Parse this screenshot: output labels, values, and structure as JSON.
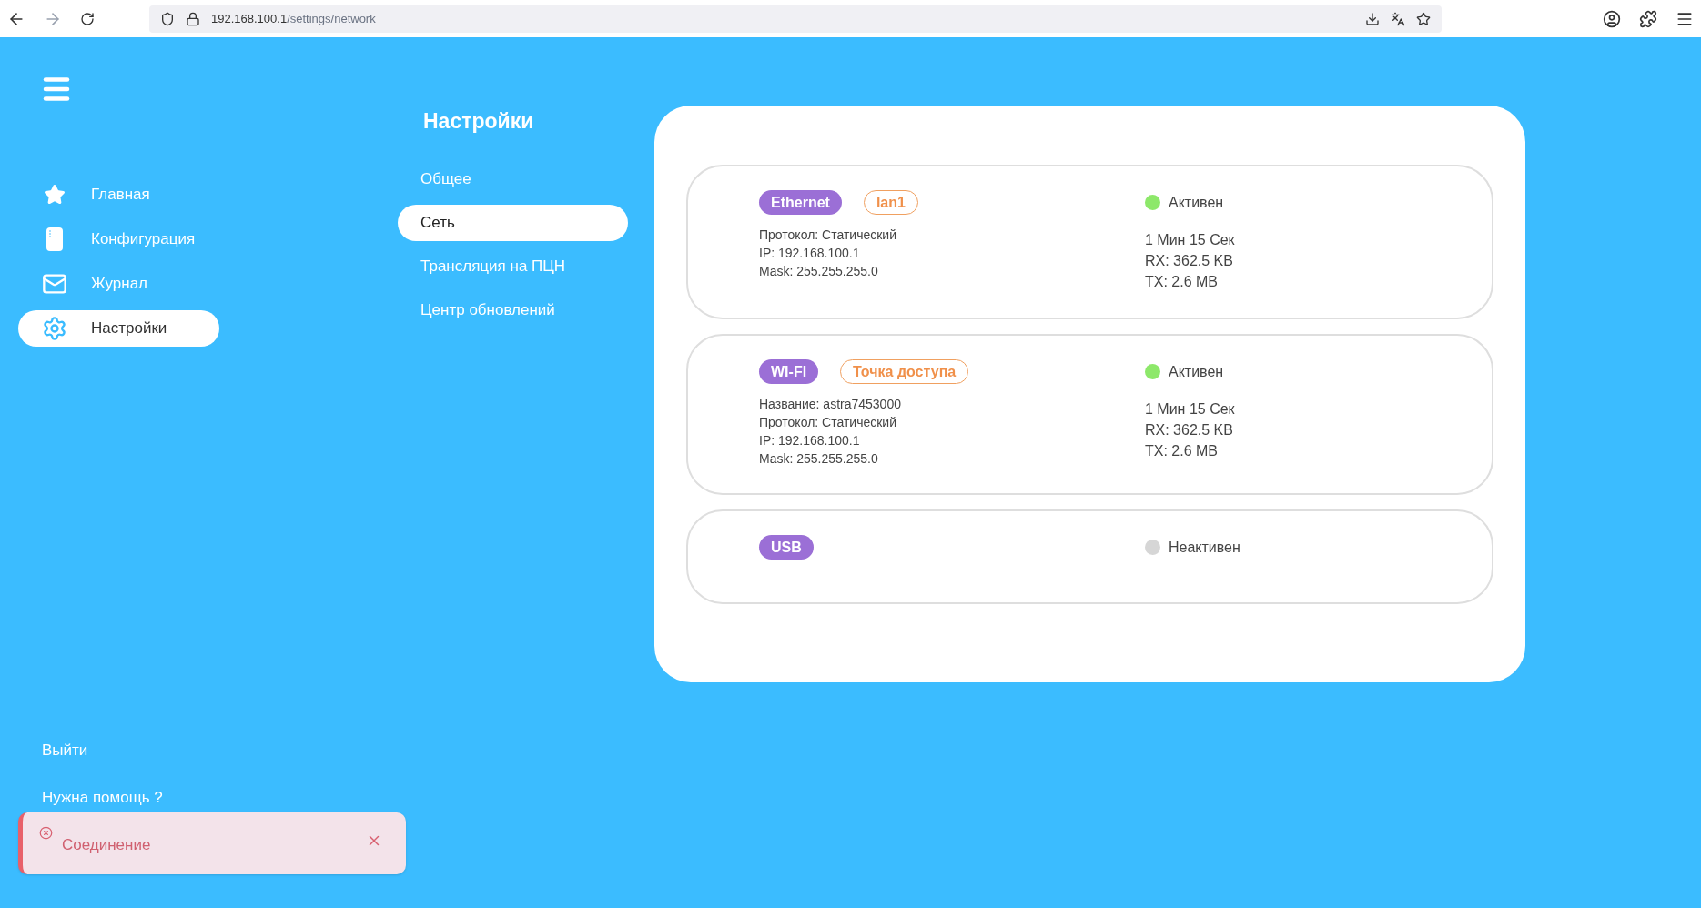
{
  "browser": {
    "url_host": "192.168.100.1",
    "url_path": "/settings/network"
  },
  "sidebar": {
    "items": [
      {
        "kind": "star",
        "label": "Главная",
        "selected": false
      },
      {
        "kind": "device",
        "label": "Конфигурация",
        "selected": false
      },
      {
        "kind": "mail",
        "label": "Журнал",
        "selected": false
      },
      {
        "kind": "gear",
        "label": "Настройки",
        "selected": true
      }
    ],
    "bottom_links": [
      "Выйти",
      "Нужна помощь ?"
    ]
  },
  "settings_menu": {
    "title": "Настройки",
    "items": [
      {
        "label": "Общее",
        "selected": false
      },
      {
        "label": "Сеть",
        "selected": true
      },
      {
        "label": "Трансляция на ПЦН",
        "selected": false
      },
      {
        "label": "Центр обновлений",
        "selected": false
      }
    ]
  },
  "interfaces": [
    {
      "type": "Ethernet",
      "mode": "lan1",
      "details": [
        "Протокол: Статический",
        "IP: 192.168.100.1",
        "Mask: 255.255.255.0"
      ],
      "active": true,
      "status": "Активен",
      "stats": [
        "1 Мин 15 Сек",
        "RX: 362.5 KB",
        "TX: 2.6 MB"
      ]
    },
    {
      "type": "WI-FI",
      "mode": "Точка доступа",
      "details": [
        "Название: astra7453000",
        "Протокол: Статический",
        "IP: 192.168.100.1",
        "Mask: 255.255.255.0"
      ],
      "active": true,
      "status": "Активен",
      "stats": [
        "1 Мин 15 Сек",
        "RX: 362.5 KB",
        "TX: 2.6 MB"
      ]
    },
    {
      "type": "USB",
      "active": false,
      "status": "Неактивен"
    }
  ],
  "toast": {
    "title": "Соединение"
  }
}
